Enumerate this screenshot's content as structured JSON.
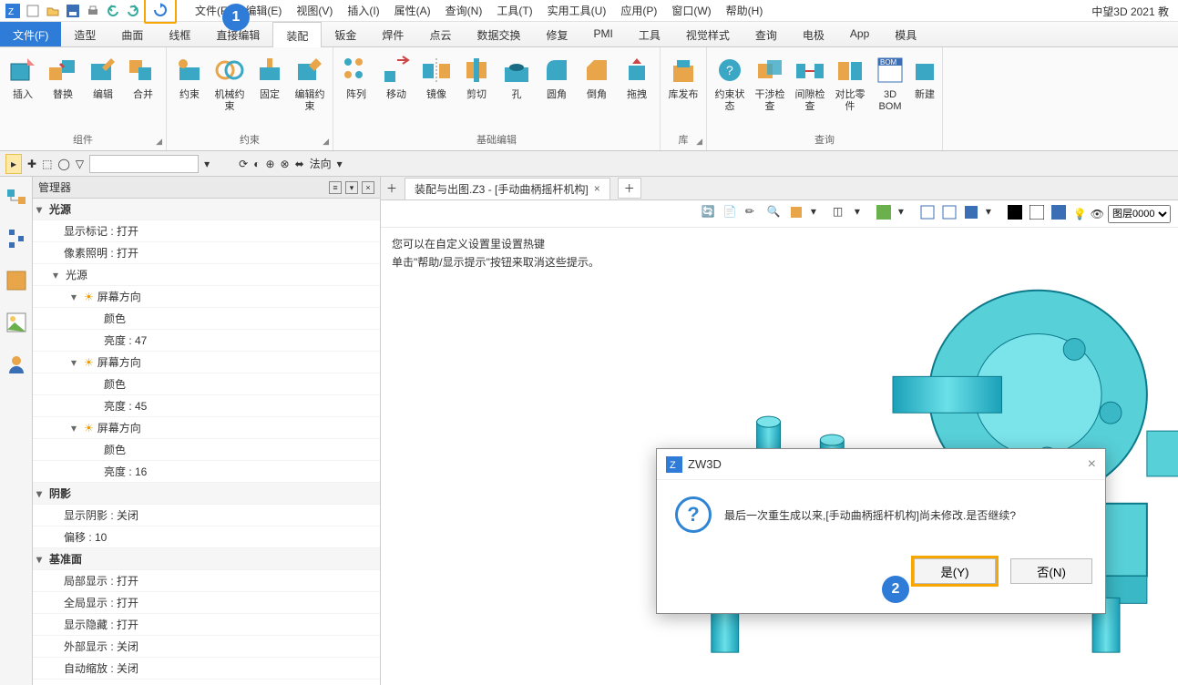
{
  "app": {
    "brand": "中望3D 2021 教"
  },
  "menu": [
    "文件(F)",
    "编辑(E)",
    "视图(V)",
    "插入(I)",
    "属性(A)",
    "查询(N)",
    "工具(T)",
    "实用工具(U)",
    "应用(P)",
    "窗口(W)",
    "帮助(H)"
  ],
  "ribbon_tabs": [
    "文件(F)",
    "造型",
    "曲面",
    "线框",
    "直接编辑",
    "装配",
    "钣金",
    "焊件",
    "点云",
    "数据交换",
    "修复",
    "PMI",
    "工具",
    "视觉样式",
    "查询",
    "电极",
    "App",
    "模具"
  ],
  "active_ribbon_tab": "装配",
  "ribbon_groups": [
    {
      "name": "组件",
      "buttons": [
        "插入",
        "替换",
        "编辑",
        "合并"
      ]
    },
    {
      "name": "约束",
      "buttons": [
        "约束",
        "机械约束",
        "固定",
        "编辑约束"
      ]
    },
    {
      "name": "基础编辑",
      "buttons": [
        "阵列",
        "移动",
        "镜像",
        "剪切",
        "孔",
        "圆角",
        "倒角",
        "拖拽"
      ]
    },
    {
      "name": "库",
      "buttons": [
        "库发布"
      ]
    },
    {
      "name": "查询",
      "buttons": [
        "约束状态",
        "干涉检查",
        "间隙检查",
        "对比零件",
        "3D BOM",
        "新建"
      ]
    }
  ],
  "toolbar2": {
    "direction_label": "法向"
  },
  "panel": {
    "title": "管理器",
    "groups": [
      {
        "label": "光源",
        "items": [
          "显示标记 : 打开",
          "像素照明 : 打开"
        ]
      },
      {
        "label": "光源",
        "sub": true,
        "items": []
      },
      {
        "label": "屏幕方向",
        "icon": true,
        "items": [
          "颜色",
          "亮度 : 47"
        ]
      },
      {
        "label": "屏幕方向",
        "icon": true,
        "items": [
          "颜色",
          "亮度 : 45"
        ]
      },
      {
        "label": "屏幕方向",
        "icon": true,
        "items": [
          "颜色",
          "亮度 : 16"
        ]
      },
      {
        "label": "阴影",
        "items": [
          "显示阴影 : 关闭",
          "偏移 : 10"
        ]
      },
      {
        "label": "基准面",
        "items": [
          "局部显示 : 打开",
          "全局显示 : 打开",
          "显示隐藏 : 打开",
          "外部显示 : 关闭",
          "自动缩放 : 关闭"
        ]
      }
    ]
  },
  "doc_tab": {
    "title": "装配与出图.Z3 - [手动曲柄摇杆机构]"
  },
  "viewport": {
    "hint1": "您可以在自定义设置里设置热键",
    "hint2": "单击\"帮助/显示提示\"按钮来取消这些提示。",
    "layer_label": "图层0000"
  },
  "dialog": {
    "title": "ZW3D",
    "message": "最后一次重生成以来,[手动曲柄摇杆机构]尚未修改.是否继续?",
    "yes": "是(Y)",
    "no": "否(N)"
  },
  "callouts": {
    "c1": "1",
    "c2": "2"
  }
}
